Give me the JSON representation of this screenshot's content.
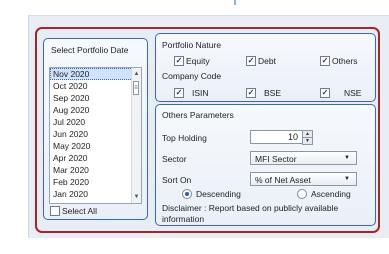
{
  "left": {
    "title": "Select Portfolio Date",
    "dates": [
      "Nov 2020",
      "Oct 2020",
      "Sep 2020",
      "Aug 2020",
      "Jul 2020",
      "Jun 2020",
      "May 2020",
      "Apr 2020",
      "Mar 2020",
      "Feb 2020",
      "Jan 2020"
    ],
    "selected_date": "Nov 2020",
    "select_all_label": "Select All"
  },
  "nature": {
    "title": "Portfolio Nature",
    "equity": "Equity",
    "debt": "Debt",
    "others": "Others",
    "company_code_title": "Company Code",
    "isin": "ISIN",
    "bse": "BSE",
    "nse": "NSE"
  },
  "others": {
    "title": "Others Parameters",
    "top_holding_label": "Top Holding",
    "top_holding_value": "10",
    "sector_label": "Sector",
    "sector_value": "MFI Sector",
    "sort_label": "Sort On",
    "sort_value": "% of Net Asset",
    "descending": "Descending",
    "ascending": "Ascending",
    "disclaimer_line1": "Disclaimer : Report based on publicly available",
    "disclaimer_line2": "information"
  },
  "scroll_glyphs": {
    "up": "▲",
    "down": "▼",
    "thumb": "≡"
  },
  "dropdown_caret": "▼"
}
